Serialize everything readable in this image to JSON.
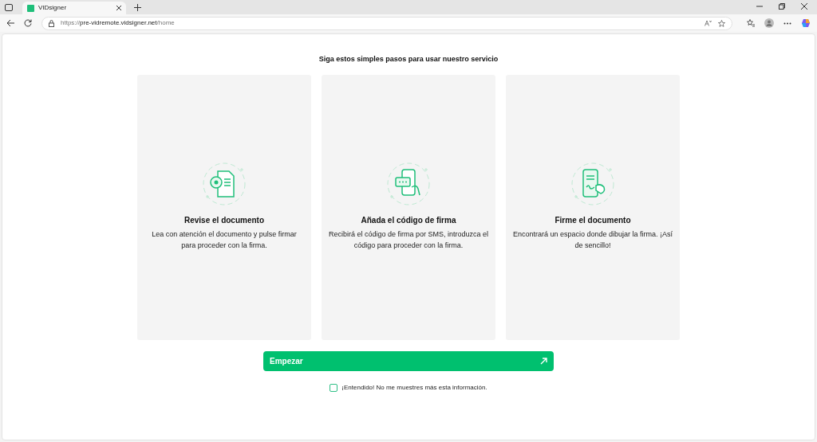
{
  "browser": {
    "tab": {
      "title": "VIDsigner",
      "selected": true
    },
    "url": {
      "scheme": "https://",
      "host": "pre-vidremote.vidsigner.net",
      "path": "/home"
    }
  },
  "heading": "Siga estos simples pasos para usar nuestro servicio",
  "steps": [
    {
      "kind": "review",
      "title": "Revise el documento",
      "text": "Lea con atención el documento y pulse firmar para proceder con la firma."
    },
    {
      "kind": "code",
      "title": "Añada el código de firma",
      "text": "Recibirá el código de firma por SMS, introduzca el código para proceder con la firma."
    },
    {
      "kind": "sign",
      "title": "Firme el documento",
      "text": "Encontrará un espacio donde dibujar la firma. ¡Así de sencillo!"
    }
  ],
  "start_button": {
    "label": "Empezar"
  },
  "dont_show": {
    "label": "¡Entendido! No me muestres más esta información.",
    "checked": false
  }
}
